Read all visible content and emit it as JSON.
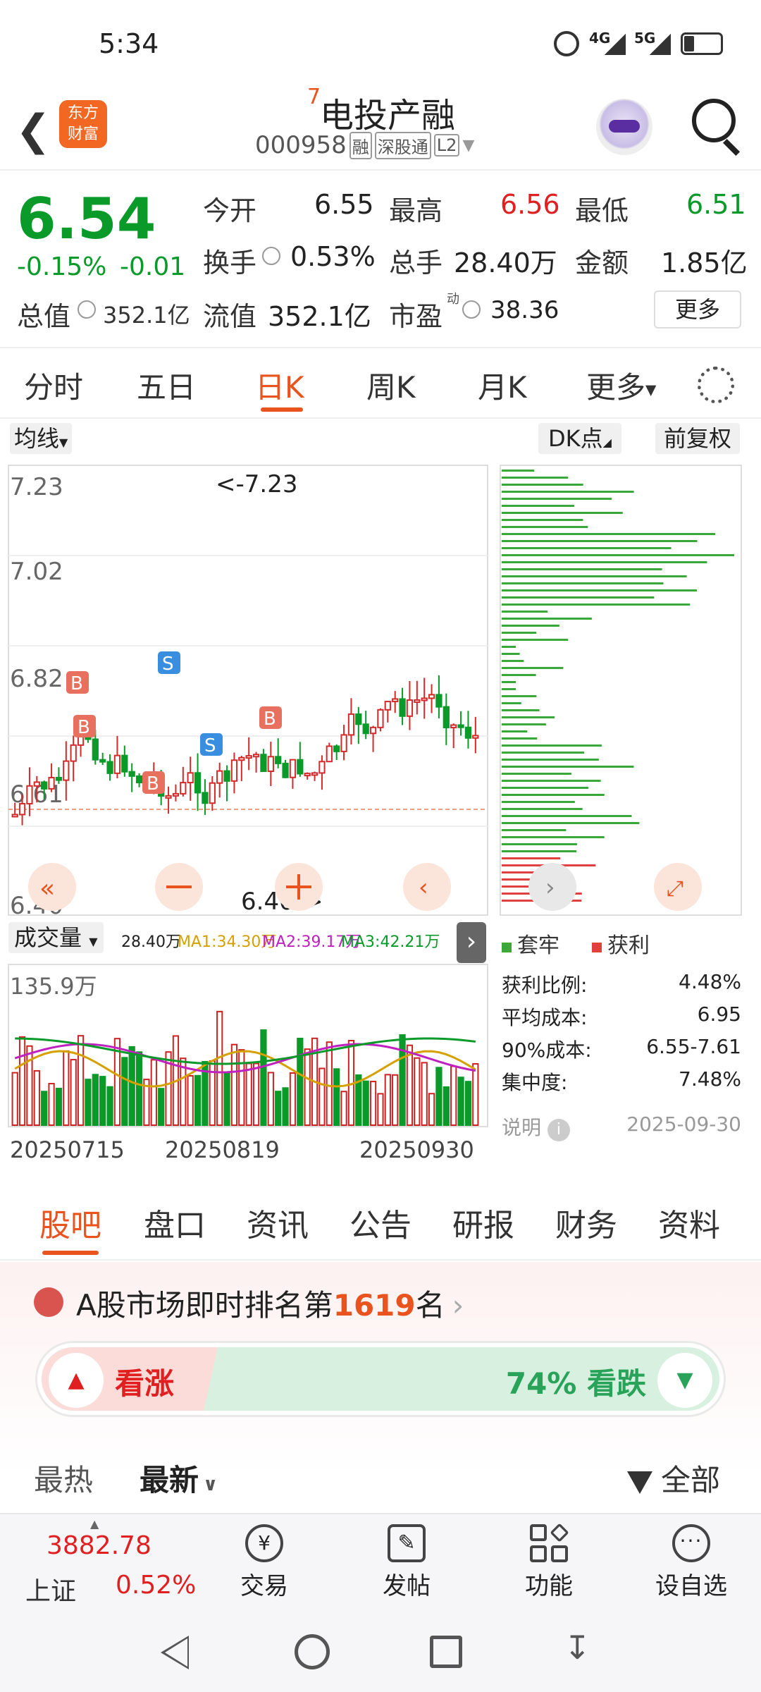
{
  "status_bar": {
    "time": "5:34",
    "net1": "4G",
    "net2": "5G"
  },
  "header": {
    "superscript": "7",
    "title": "电投产融",
    "code": "000958",
    "tag1": "融",
    "tag2": "深股通",
    "tag3": "L2",
    "logo_line1": "东方",
    "logo_line2": "财富"
  },
  "quote": {
    "price": "6.54",
    "change_pct": "-0.15%",
    "change": "-0.01",
    "open_label": "今开",
    "open": "6.55",
    "high_label": "最高",
    "high": "6.56",
    "low_label": "最低",
    "low": "6.51",
    "turnover_label": "换手",
    "turnover": "0.53%",
    "volume_label": "总手",
    "volume": "28.40万",
    "amount_label": "金额",
    "amount": "1.85亿",
    "mktcap_label": "总值",
    "mktcap": "352.1亿",
    "float_label": "流值",
    "float": "352.1亿",
    "pe_label": "市盈",
    "pe_sup": "动",
    "pe": "38.36",
    "more": "更多"
  },
  "tabs": [
    "分时",
    "五日",
    "日K",
    "周K",
    "月K",
    "更多"
  ],
  "chart": {
    "ma_btn": "均线",
    "dk_btn": "DK点",
    "adj_btn": "前复权",
    "y_labels": [
      "7.23",
      "7.02",
      "6.82",
      "6.61",
      "6.40"
    ],
    "max_note": "<-7.23",
    "min_note": "6.40->",
    "vol_btn": "成交量",
    "vol_info": "28.40万",
    "ma1": "MA1:34.30万",
    "ma2": "MA2:39.17万",
    "ma3": "MA3:42.21万",
    "vol_max": "135.9万",
    "dates": [
      "20250715",
      "20250819",
      "20250930"
    ],
    "legend_a": "套牢",
    "legend_b": "获利",
    "stats": [
      {
        "k": "获利比例:",
        "v": "4.48%"
      },
      {
        "k": "平均成本:",
        "v": "6.95"
      },
      {
        "k": "90%成本:",
        "v": "6.55-7.61"
      },
      {
        "k": "集中度:",
        "v": "7.48%"
      }
    ],
    "note_label": "说明",
    "note_date": "2025-09-30",
    "markers": [
      "B",
      "B",
      "B",
      "S",
      "S",
      "B"
    ]
  },
  "section_tabs": [
    "股吧",
    "盘口",
    "资讯",
    "公告",
    "研报",
    "财务",
    "资料"
  ],
  "rank": {
    "prefix": "A股市场即时排名第",
    "num": "1619",
    "suffix": "名",
    "bull": "看涨",
    "bear": "74% 看跌",
    "bear_pct": 74
  },
  "feed": {
    "hot": "最热",
    "new": "最新",
    "filter": "全部"
  },
  "bottom": {
    "index_val": "3882.78",
    "index_name": "上证",
    "index_pct": "0.52%",
    "trade": "交易",
    "post": "发帖",
    "func": "功能",
    "watch": "设自选"
  },
  "colors": {
    "up": "#e02020",
    "down": "#0a9a2a",
    "accent": "#e8531e"
  }
}
